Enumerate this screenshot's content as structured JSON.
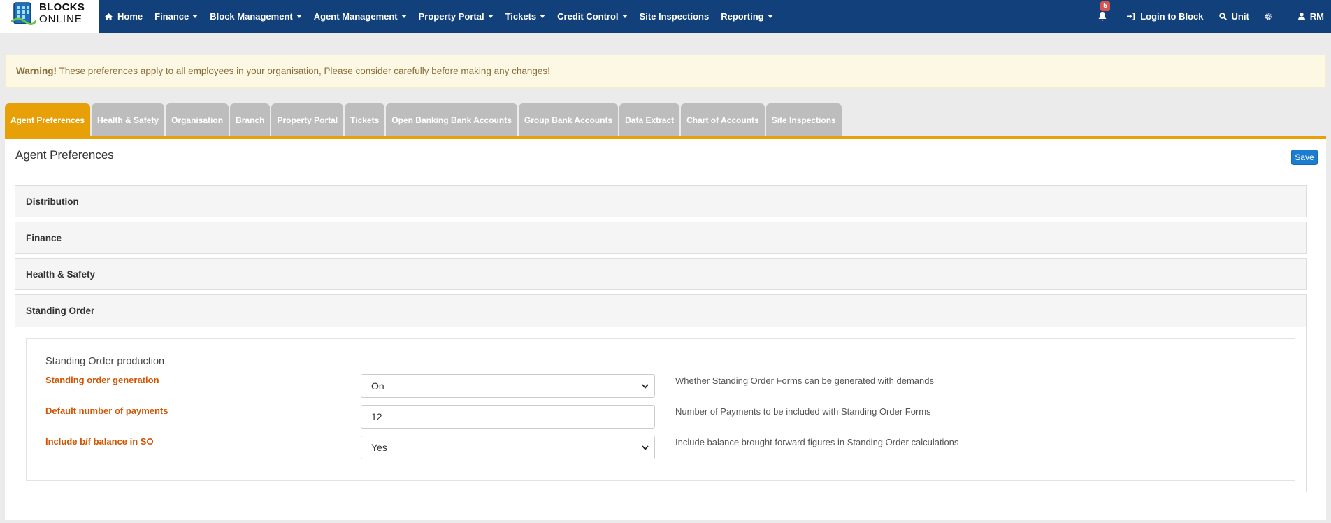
{
  "brand": {
    "line1": "BLOCKS",
    "line2": "ONLINE",
    "icon": "building-logo-icon"
  },
  "nav": {
    "items": [
      {
        "label": "Home",
        "icon": "home-icon",
        "caret": false
      },
      {
        "label": "Finance",
        "caret": true
      },
      {
        "label": "Block Management",
        "caret": true
      },
      {
        "label": "Agent Management",
        "caret": true
      },
      {
        "label": "Property Portal",
        "caret": true
      },
      {
        "label": "Tickets",
        "caret": true
      },
      {
        "label": "Credit Control",
        "caret": true
      },
      {
        "label": "Site Inspections",
        "caret": false
      },
      {
        "label": "Reporting",
        "caret": true
      }
    ],
    "right": {
      "notifications_count": "5",
      "login_to_block": "Login to Block",
      "unit": "Unit",
      "user": "RM"
    }
  },
  "warning": {
    "strong": "Warning!",
    "text": " These preferences apply to all employees in your organisation, Please consider carefully before making any changes!"
  },
  "tabs": [
    {
      "label": "Agent Preferences",
      "active": true
    },
    {
      "label": "Health & Safety"
    },
    {
      "label": "Organisation"
    },
    {
      "label": "Branch"
    },
    {
      "label": "Property Portal"
    },
    {
      "label": "Tickets"
    },
    {
      "label": "Open Banking Bank Accounts"
    },
    {
      "label": "Group Bank Accounts"
    },
    {
      "label": "Data Extract"
    },
    {
      "label": "Chart of Accounts"
    },
    {
      "label": "Site Inspections"
    }
  ],
  "panel": {
    "title": "Agent Preferences",
    "save_label": "Save",
    "sections": [
      "Distribution",
      "Finance",
      "Health & Safety",
      "Standing Order"
    ],
    "standing_order": {
      "title": "Standing Order production",
      "fields": [
        {
          "label": "Standing order generation",
          "value": "On",
          "type": "select",
          "help": "Whether Standing Order Forms can be generated with demands"
        },
        {
          "label": "Default number of payments",
          "value": "12",
          "type": "input",
          "help": "Number of Payments to be included with Standing Order Forms"
        },
        {
          "label": "Include b/f balance in SO",
          "value": "Yes",
          "type": "select",
          "help": "Include balance brought forward figures in Standing Order calculations"
        }
      ]
    }
  },
  "colors": {
    "navbar": "#12407a",
    "tab_active": "#e8a009",
    "tab_inactive": "#bdbdbd",
    "field_label": "#d35400",
    "save_button": "#1b7cd0"
  }
}
